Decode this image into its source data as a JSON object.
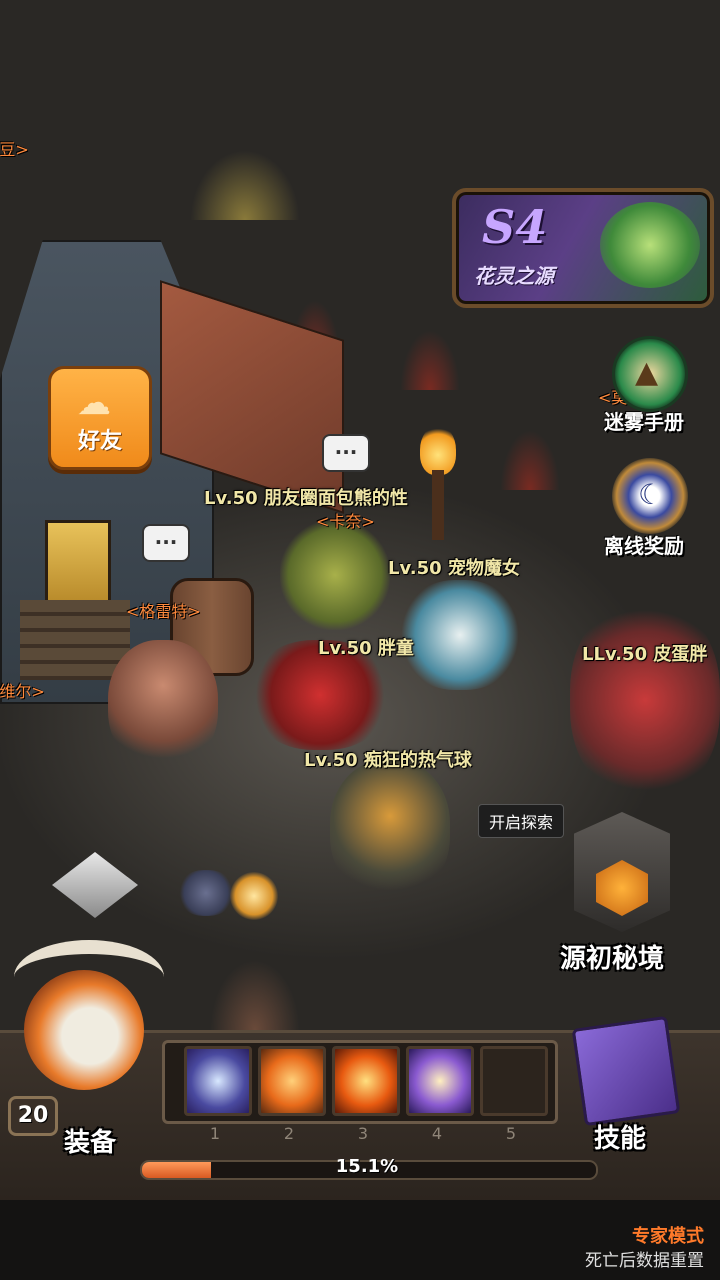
{
  "season_banner": {
    "badge": "S4",
    "title": "花灵之源"
  },
  "left_menu": {
    "friends_label": "好友"
  },
  "right_menu": {
    "fog_manual": "迷雾手册",
    "offline_reward": "离线奖励"
  },
  "players": [
    {
      "level_name": "Lv.50 朋友圈面包熊的性"
    },
    {
      "level_name": "Lv.50 宠物魔女"
    },
    {
      "level_name": "Lv.50 胖童"
    },
    {
      "level_name": "Lv.50 痴狂的热气球"
    },
    {
      "level_name": "LLv.50 皮蛋胖"
    }
  ],
  "npcs": {
    "top_left": "<豆>",
    "kana": "<卡奈>",
    "gelait": "<格雷特>",
    "left_edge": "<维尔>",
    "right_edge": "<莫"
  },
  "speech_bubble": "...",
  "explore": {
    "tooltip": "开启探索",
    "label": "源初秘境"
  },
  "bottom_bar": {
    "equip_label": "装备",
    "level": "20",
    "skills_label": "技能",
    "slot_numbers": [
      "1",
      "2",
      "3",
      "4",
      "5"
    ],
    "progress_text": "15.1%",
    "progress_value": 15.1
  },
  "mode": {
    "title": "专家模式",
    "subtitle": "死亡后数据重置"
  },
  "colors": {
    "accent_orange": "#f08a1a",
    "name_gold": "#f1e7a8",
    "npc_orange": "#ff8a3d",
    "mode_orange": "#ff7a2a"
  }
}
